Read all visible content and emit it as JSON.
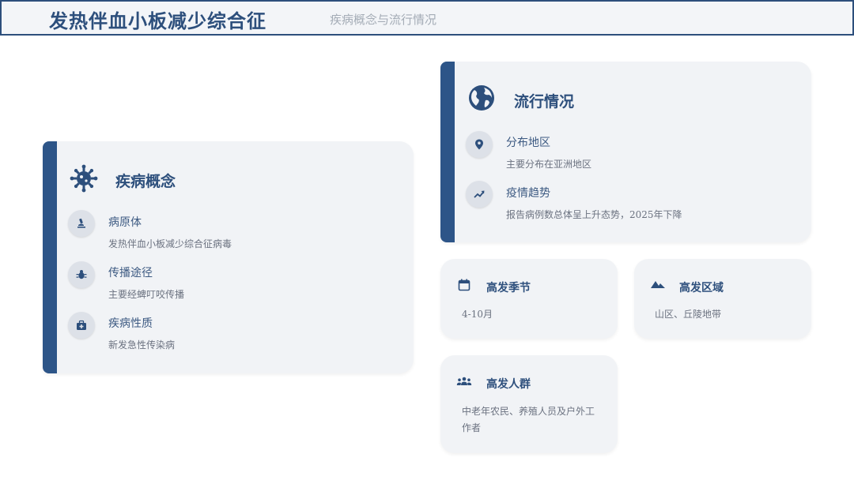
{
  "header": {
    "title": "发热伴血小板减少综合征",
    "subtitle": "疾病概念与流行情况"
  },
  "concept": {
    "title": "疾病概念",
    "icon": "virus-icon",
    "items": [
      {
        "icon": "microscope-icon",
        "title": "病原体",
        "text": "发热伴血小板减少综合征病毒"
      },
      {
        "icon": "bug-icon",
        "title": "传播途径",
        "text": "主要经蜱叮咬传播"
      },
      {
        "icon": "medical-kit-icon",
        "title": "疾病性质",
        "text": "新发急性传染病"
      }
    ]
  },
  "epidemic": {
    "title": "流行情况",
    "icon": "globe-icon",
    "items": [
      {
        "icon": "location-pin-icon",
        "title": "分布地区",
        "text": "主要分布在亚洲地区"
      },
      {
        "icon": "trend-up-icon",
        "title": "疫情趋势",
        "text": "报告病例数总体呈上升态势，2025年下降"
      }
    ]
  },
  "season": {
    "icon": "calendar-icon",
    "title": "高发季节",
    "text": "4-10月"
  },
  "region": {
    "icon": "mountain-icon",
    "title": "高发区域",
    "text": "山区、丘陵地带"
  },
  "people": {
    "icon": "group-icon",
    "title": "高发人群",
    "text_line1": "中老年农民、养殖人员及户外工",
    "text_line2": "作者"
  },
  "colors": {
    "accent": "#2d5588",
    "card_bg": "#f1f3f6",
    "title": "#2d4f7c"
  }
}
